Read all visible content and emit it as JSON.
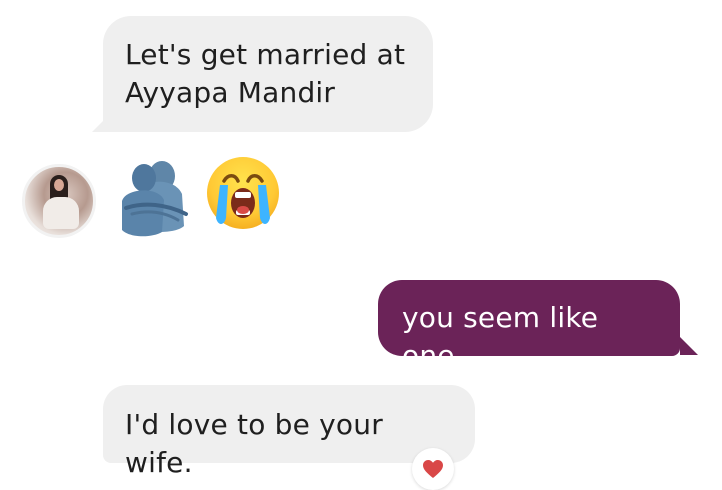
{
  "messages": {
    "first": {
      "text": "Let's get married at Ayyapa Mandir"
    },
    "second": {
      "text": "you seem like one"
    },
    "third": {
      "text": "I'd love to be your wife."
    }
  },
  "emoji_row": {
    "items": [
      {
        "icon": "avatar-photo"
      },
      {
        "icon": "hug-icon"
      },
      {
        "icon": "crying-face-icon"
      }
    ]
  },
  "reaction": {
    "icon": "heart-icon",
    "color": "#d94747"
  },
  "colors": {
    "incoming_bubble": "#efefef",
    "outgoing_bubble": "#6b2358"
  }
}
